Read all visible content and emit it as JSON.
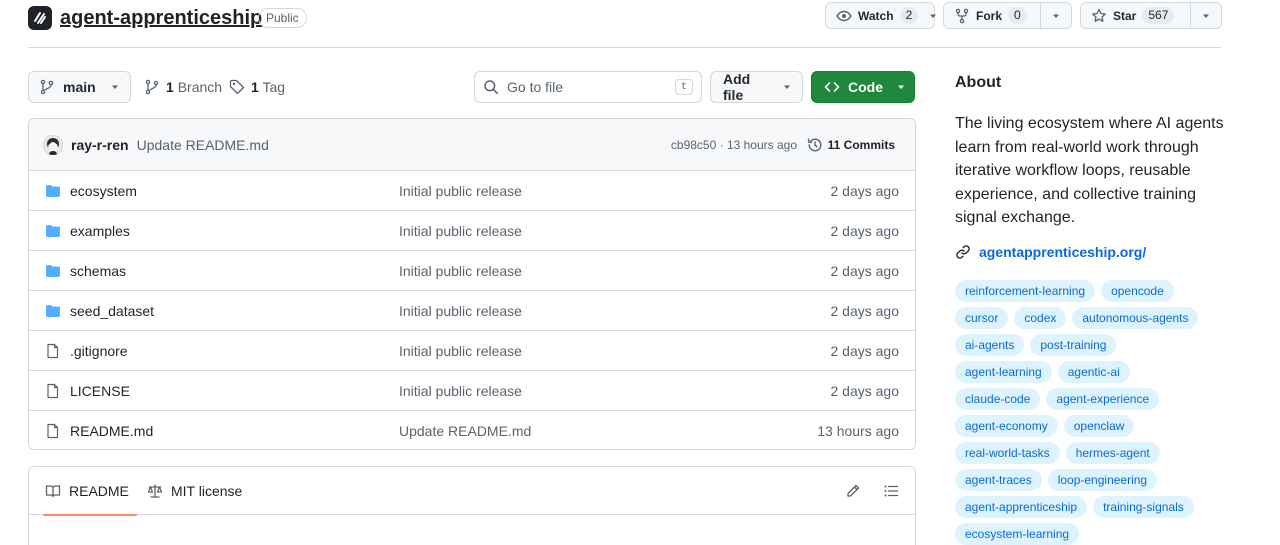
{
  "repo": {
    "name": "agent-apprenticeship",
    "visibility": "Public"
  },
  "actions": {
    "watch": {
      "label": "Watch",
      "count": "2"
    },
    "fork": {
      "label": "Fork",
      "count": "0"
    },
    "star": {
      "label": "Star",
      "count": "567"
    }
  },
  "toolbar": {
    "branch": "main",
    "branches_count": "1",
    "branches_label": "Branch",
    "tags_count": "1",
    "tags_label": "Tag",
    "search_placeholder": "Go to file",
    "search_shortcut": "t",
    "add_file": "Add file",
    "code": "Code"
  },
  "latest_commit": {
    "author": "ray-r-ren",
    "message": "Update README.md",
    "meta": "cb98c50 · 13 hours ago",
    "commits_label": "11 Commits"
  },
  "files": [
    {
      "type": "folder",
      "name": "ecosystem",
      "message": "Initial public release",
      "date": "2 days ago"
    },
    {
      "type": "folder",
      "name": "examples",
      "message": "Initial public release",
      "date": "2 days ago"
    },
    {
      "type": "folder",
      "name": "schemas",
      "message": "Initial public release",
      "date": "2 days ago"
    },
    {
      "type": "folder",
      "name": "seed_dataset",
      "message": "Initial public release",
      "date": "2 days ago"
    },
    {
      "type": "file",
      "name": ".gitignore",
      "message": "Initial public release",
      "date": "2 days ago"
    },
    {
      "type": "file",
      "name": "LICENSE",
      "message": "Initial public release",
      "date": "2 days ago"
    },
    {
      "type": "file",
      "name": "README.md",
      "message": "Update README.md",
      "date": "13 hours ago"
    }
  ],
  "readme": {
    "tab_readme": "README",
    "tab_license": "MIT license"
  },
  "about": {
    "title": "About",
    "description": "The living ecosystem where AI agents learn from real-world work through iterative workflow loops, reusable experience, and collective training signal exchange.",
    "link": "agentapprenticeship.org/",
    "topics": [
      [
        "reinforcement-learning",
        "opencode"
      ],
      [
        "cursor",
        "codex",
        "autonomous-agents"
      ],
      [
        "ai-agents",
        "post-training"
      ],
      [
        "agent-learning",
        "agentic-ai"
      ],
      [
        "claude-code",
        "agent-experience"
      ],
      [
        "agent-economy",
        "openclaw"
      ],
      [
        "real-world-tasks",
        "hermes-agent"
      ],
      [
        "agent-traces",
        "loop-engineering"
      ],
      [
        "agent-apprenticeship",
        "training-signals"
      ],
      [
        "ecosystem-learning"
      ]
    ]
  },
  "colors": {
    "accent": "#0969da",
    "code_button": "#1f883d",
    "folder": "#54aeff",
    "topic_bg": "#ddf4ff",
    "active_tab": "#fd8c73"
  }
}
